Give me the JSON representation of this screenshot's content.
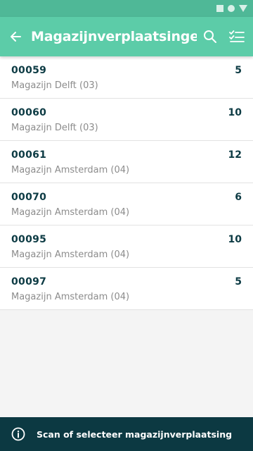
{
  "app_bar": {
    "title": "Magazijnverplaatsingen"
  },
  "transfers": [
    {
      "code": "00059",
      "location": "Magazijn Delft (03)",
      "quantity": "5"
    },
    {
      "code": "00060",
      "location": "Magazijn Delft (03)",
      "quantity": "10"
    },
    {
      "code": "00061",
      "location": "Magazijn Amsterdam (04)",
      "quantity": "12"
    },
    {
      "code": "00070",
      "location": "Magazijn Amsterdam (04)",
      "quantity": "6"
    },
    {
      "code": "00095",
      "location": "Magazijn Amsterdam (04)",
      "quantity": "10"
    },
    {
      "code": "00097",
      "location": "Magazijn Amsterdam (04)",
      "quantity": "5"
    }
  ],
  "snackbar": {
    "message": "Scan of selecteer magazijnverplaatsing"
  },
  "colors": {
    "status_bar": "#4fb897",
    "app_bar": "#5ccca8",
    "primary_text": "#0d3b44",
    "secondary_text": "#8c8c8c",
    "snackbar": "#0c3942"
  },
  "icons": {
    "back": "arrow-left-icon",
    "search": "search-icon",
    "filter": "checklist-icon",
    "info": "info-icon"
  }
}
